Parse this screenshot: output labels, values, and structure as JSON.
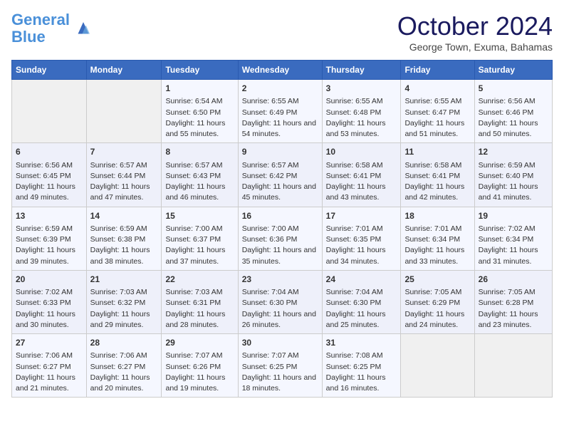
{
  "header": {
    "logo_line1": "General",
    "logo_line2": "Blue",
    "month": "October 2024",
    "location": "George Town, Exuma, Bahamas"
  },
  "days_of_week": [
    "Sunday",
    "Monday",
    "Tuesday",
    "Wednesday",
    "Thursday",
    "Friday",
    "Saturday"
  ],
  "weeks": [
    [
      {
        "day": "",
        "content": ""
      },
      {
        "day": "",
        "content": ""
      },
      {
        "day": "1",
        "content": "Sunrise: 6:54 AM\nSunset: 6:50 PM\nDaylight: 11 hours and 55 minutes."
      },
      {
        "day": "2",
        "content": "Sunrise: 6:55 AM\nSunset: 6:49 PM\nDaylight: 11 hours and 54 minutes."
      },
      {
        "day": "3",
        "content": "Sunrise: 6:55 AM\nSunset: 6:48 PM\nDaylight: 11 hours and 53 minutes."
      },
      {
        "day": "4",
        "content": "Sunrise: 6:55 AM\nSunset: 6:47 PM\nDaylight: 11 hours and 51 minutes."
      },
      {
        "day": "5",
        "content": "Sunrise: 6:56 AM\nSunset: 6:46 PM\nDaylight: 11 hours and 50 minutes."
      }
    ],
    [
      {
        "day": "6",
        "content": "Sunrise: 6:56 AM\nSunset: 6:45 PM\nDaylight: 11 hours and 49 minutes."
      },
      {
        "day": "7",
        "content": "Sunrise: 6:57 AM\nSunset: 6:44 PM\nDaylight: 11 hours and 47 minutes."
      },
      {
        "day": "8",
        "content": "Sunrise: 6:57 AM\nSunset: 6:43 PM\nDaylight: 11 hours and 46 minutes."
      },
      {
        "day": "9",
        "content": "Sunrise: 6:57 AM\nSunset: 6:42 PM\nDaylight: 11 hours and 45 minutes."
      },
      {
        "day": "10",
        "content": "Sunrise: 6:58 AM\nSunset: 6:41 PM\nDaylight: 11 hours and 43 minutes."
      },
      {
        "day": "11",
        "content": "Sunrise: 6:58 AM\nSunset: 6:41 PM\nDaylight: 11 hours and 42 minutes."
      },
      {
        "day": "12",
        "content": "Sunrise: 6:59 AM\nSunset: 6:40 PM\nDaylight: 11 hours and 41 minutes."
      }
    ],
    [
      {
        "day": "13",
        "content": "Sunrise: 6:59 AM\nSunset: 6:39 PM\nDaylight: 11 hours and 39 minutes."
      },
      {
        "day": "14",
        "content": "Sunrise: 6:59 AM\nSunset: 6:38 PM\nDaylight: 11 hours and 38 minutes."
      },
      {
        "day": "15",
        "content": "Sunrise: 7:00 AM\nSunset: 6:37 PM\nDaylight: 11 hours and 37 minutes."
      },
      {
        "day": "16",
        "content": "Sunrise: 7:00 AM\nSunset: 6:36 PM\nDaylight: 11 hours and 35 minutes."
      },
      {
        "day": "17",
        "content": "Sunrise: 7:01 AM\nSunset: 6:35 PM\nDaylight: 11 hours and 34 minutes."
      },
      {
        "day": "18",
        "content": "Sunrise: 7:01 AM\nSunset: 6:34 PM\nDaylight: 11 hours and 33 minutes."
      },
      {
        "day": "19",
        "content": "Sunrise: 7:02 AM\nSunset: 6:34 PM\nDaylight: 11 hours and 31 minutes."
      }
    ],
    [
      {
        "day": "20",
        "content": "Sunrise: 7:02 AM\nSunset: 6:33 PM\nDaylight: 11 hours and 30 minutes."
      },
      {
        "day": "21",
        "content": "Sunrise: 7:03 AM\nSunset: 6:32 PM\nDaylight: 11 hours and 29 minutes."
      },
      {
        "day": "22",
        "content": "Sunrise: 7:03 AM\nSunset: 6:31 PM\nDaylight: 11 hours and 28 minutes."
      },
      {
        "day": "23",
        "content": "Sunrise: 7:04 AM\nSunset: 6:30 PM\nDaylight: 11 hours and 26 minutes."
      },
      {
        "day": "24",
        "content": "Sunrise: 7:04 AM\nSunset: 6:30 PM\nDaylight: 11 hours and 25 minutes."
      },
      {
        "day": "25",
        "content": "Sunrise: 7:05 AM\nSunset: 6:29 PM\nDaylight: 11 hours and 24 minutes."
      },
      {
        "day": "26",
        "content": "Sunrise: 7:05 AM\nSunset: 6:28 PM\nDaylight: 11 hours and 23 minutes."
      }
    ],
    [
      {
        "day": "27",
        "content": "Sunrise: 7:06 AM\nSunset: 6:27 PM\nDaylight: 11 hours and 21 minutes."
      },
      {
        "day": "28",
        "content": "Sunrise: 7:06 AM\nSunset: 6:27 PM\nDaylight: 11 hours and 20 minutes."
      },
      {
        "day": "29",
        "content": "Sunrise: 7:07 AM\nSunset: 6:26 PM\nDaylight: 11 hours and 19 minutes."
      },
      {
        "day": "30",
        "content": "Sunrise: 7:07 AM\nSunset: 6:25 PM\nDaylight: 11 hours and 18 minutes."
      },
      {
        "day": "31",
        "content": "Sunrise: 7:08 AM\nSunset: 6:25 PM\nDaylight: 11 hours and 16 minutes."
      },
      {
        "day": "",
        "content": ""
      },
      {
        "day": "",
        "content": ""
      }
    ]
  ]
}
